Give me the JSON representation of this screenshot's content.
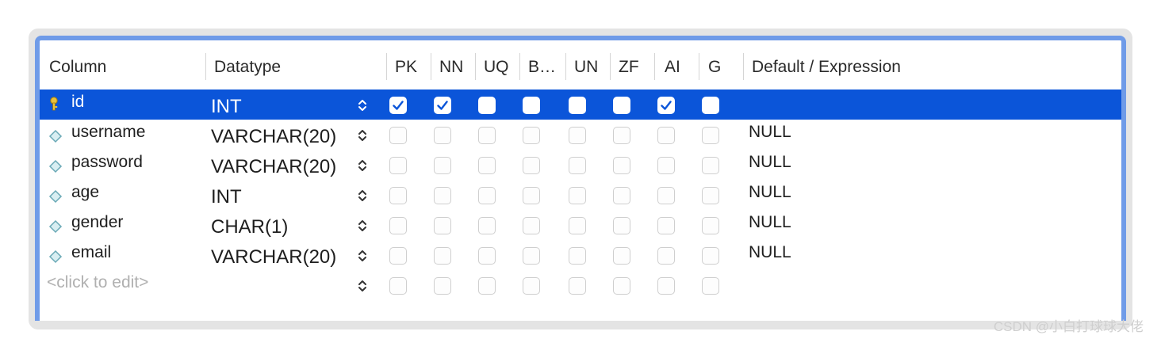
{
  "header": {
    "column": "Column",
    "datatype": "Datatype",
    "flags": [
      "PK",
      "NN",
      "UQ",
      "B…",
      "UN",
      "ZF",
      "AI",
      "G"
    ],
    "default": "Default / Expression"
  },
  "rows": [
    {
      "name": "id",
      "type": "INT",
      "flags": [
        true,
        true,
        false,
        false,
        false,
        false,
        true,
        false
      ],
      "default": "",
      "icon": "primary-key-icon",
      "selected": true
    },
    {
      "name": "username",
      "type": "VARCHAR(20)",
      "flags": [
        false,
        false,
        false,
        false,
        false,
        false,
        false,
        false
      ],
      "default": "NULL",
      "icon": "column-diamond-icon",
      "selected": false
    },
    {
      "name": "password",
      "type": "VARCHAR(20)",
      "flags": [
        false,
        false,
        false,
        false,
        false,
        false,
        false,
        false
      ],
      "default": "NULL",
      "icon": "column-diamond-icon",
      "selected": false
    },
    {
      "name": "age",
      "type": "INT",
      "flags": [
        false,
        false,
        false,
        false,
        false,
        false,
        false,
        false
      ],
      "default": "NULL",
      "icon": "column-diamond-icon",
      "selected": false
    },
    {
      "name": "gender",
      "type": "CHAR(1)",
      "flags": [
        false,
        false,
        false,
        false,
        false,
        false,
        false,
        false
      ],
      "default": "NULL",
      "icon": "column-diamond-icon",
      "selected": false
    },
    {
      "name": "email",
      "type": "VARCHAR(20)",
      "flags": [
        false,
        false,
        false,
        false,
        false,
        false,
        false,
        false
      ],
      "default": "NULL",
      "icon": "column-diamond-icon",
      "selected": false
    }
  ],
  "new_row": {
    "placeholder": "<click to edit>"
  },
  "watermark": "CSDN @小白打球球大佬",
  "colors": {
    "selection": "#0b55d9",
    "frame": "#6f9be8"
  }
}
